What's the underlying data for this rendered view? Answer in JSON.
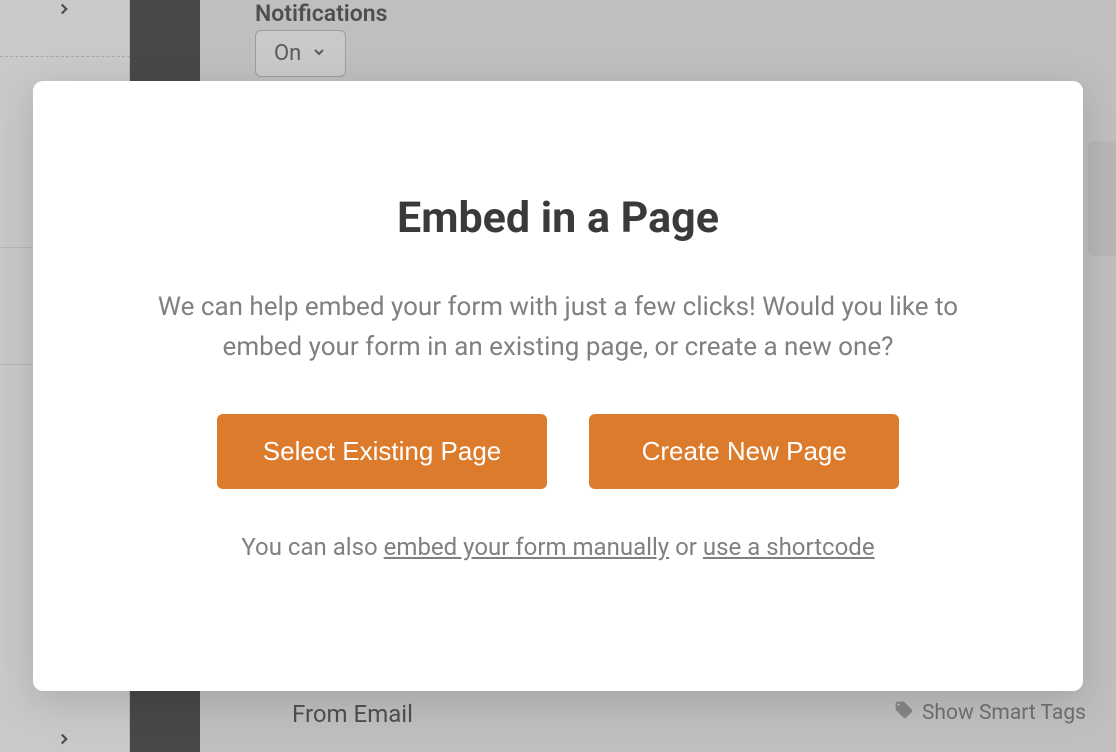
{
  "background": {
    "notifications_label": "Notifications",
    "dropdown_value": "On",
    "from_email_label": "From Email",
    "smart_tags_label": "Show Smart Tags"
  },
  "modal": {
    "title": "Embed in a Page",
    "description": "We can help embed your form with just a few clicks! Would you like to embed your form in an existing page, or create a new one?",
    "button_select_existing": "Select Existing Page",
    "button_create_new": "Create New Page",
    "footer_prefix": "You can also ",
    "footer_link1": "embed your form manually",
    "footer_middle": " or ",
    "footer_link2": "use a shortcode"
  }
}
